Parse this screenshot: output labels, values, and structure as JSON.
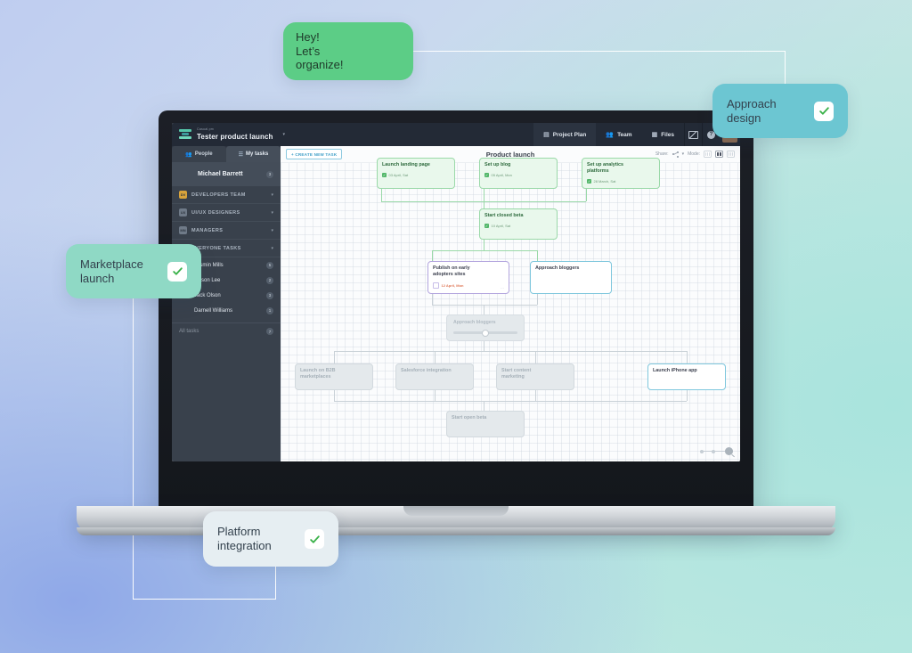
{
  "app": {
    "brand_sub": "Casual.pm",
    "project_name": "Tester product launch",
    "project_caret": "▾",
    "topnav": [
      {
        "label": "Project Plan",
        "icon": "document-icon",
        "active": true
      },
      {
        "label": "Team",
        "icon": "people-icon",
        "active": false
      },
      {
        "label": "Files",
        "icon": "files-icon",
        "active": false
      }
    ],
    "topright": [
      {
        "name": "mail-icon",
        "glyph": "✉"
      },
      {
        "name": "help-icon",
        "glyph": "?"
      }
    ]
  },
  "sidebar": {
    "tabs": [
      {
        "label": "People",
        "icon": "people-icon",
        "active": true
      },
      {
        "label": "My tasks",
        "icon": "list-icon",
        "active": false
      }
    ],
    "current_user": {
      "name": "Michael Barrett",
      "count": "3"
    },
    "groups": [
      {
        "label": "DEVELOPERS TEAM",
        "initials": "DV",
        "caret": "▾"
      },
      {
        "label": "UI/UX DESIGNERS",
        "initials": "UX",
        "caret": "▾"
      },
      {
        "label": "MANAGERS",
        "initials": "MN",
        "caret": "▾"
      },
      {
        "label": "EVERYONE TASKS",
        "initials": "EV",
        "caret": "▾"
      }
    ],
    "people": [
      {
        "name": "Jasmin Mills",
        "count": "5"
      },
      {
        "name": "Allison Lee",
        "count": "2"
      },
      {
        "name": "Jack Olson",
        "count": "3"
      },
      {
        "name": "Darnell Williams",
        "count": "1"
      }
    ],
    "all_tasks": {
      "label": "All tasks",
      "count": "7"
    }
  },
  "canvas": {
    "create_button": "+ CREATE NEW TASK",
    "title": "Product launch",
    "share_label": "Share:",
    "mode_label": "Mode:",
    "zoom_label": "zoom-slider"
  },
  "tasks": [
    {
      "id": "launch-landing-page",
      "title": "Launch landing page",
      "date": "03 April, Sat",
      "style": "green"
    },
    {
      "id": "set-up-blog",
      "title": "Set up blog",
      "date": "05 April, Mon",
      "style": "green"
    },
    {
      "id": "set-up-analytics-platforms",
      "title": "Set up analytics platforms",
      "date": "28 March, Sat",
      "style": "green"
    },
    {
      "id": "start-closed-beta",
      "title": "Start closed beta",
      "date": "10 April, Sat",
      "style": "green"
    },
    {
      "id": "publish-on-early-adopters-sites",
      "title": "Publish on early adopters sites",
      "date": "12 April, Mon",
      "style": "purple"
    },
    {
      "id": "approach-bloggers",
      "title": "Approach bloggers",
      "date": "",
      "style": "blue"
    },
    {
      "id": "launch-on-b2b-marketplaces",
      "title": "Launch on B2B marketplaces",
      "date": "",
      "style": "grey"
    },
    {
      "id": "salesforce-integration",
      "title": "Salesforce integration",
      "date": "",
      "style": "grey"
    },
    {
      "id": "start-content-marketing",
      "title": "Start content marketing",
      "date": "",
      "style": "grey"
    },
    {
      "id": "launch-iphone-app",
      "title": "Launch iPhone app",
      "date": "",
      "style": "blue"
    },
    {
      "id": "start-open-beta",
      "title": "Start open beta",
      "date": "",
      "style": "grey"
    }
  ],
  "ghost_card": {
    "title": "Approach bloggers"
  },
  "callouts": [
    {
      "id": "message",
      "text": "Hey!\nLet’s organize!",
      "style": "msg",
      "has_avatar": true,
      "has_check": false
    },
    {
      "id": "approach-design",
      "text": "Approach\ndesign",
      "style": "teal",
      "has_avatar": false,
      "has_check": true
    },
    {
      "id": "marketplace-launch",
      "text": "Marketplace\nlaunch",
      "style": "mint",
      "has_avatar": false,
      "has_check": true
    },
    {
      "id": "platform-integration",
      "text": "Platform\nintegration",
      "style": "pale",
      "has_avatar": false,
      "has_check": true
    }
  ],
  "colors": {
    "accent_green": "#5ccd86",
    "accent_teal": "#6cc6d2",
    "accent_mint": "#8fd9c5",
    "accent_pale": "#e6eef2",
    "chrome_dark": "#232a36",
    "sidebar": "#39414c",
    "card_green_border": "#9ad9a8",
    "card_purple_border": "#b3a5de",
    "card_blue_border": "#7fc7dd",
    "check_green": "#3bb24a"
  }
}
